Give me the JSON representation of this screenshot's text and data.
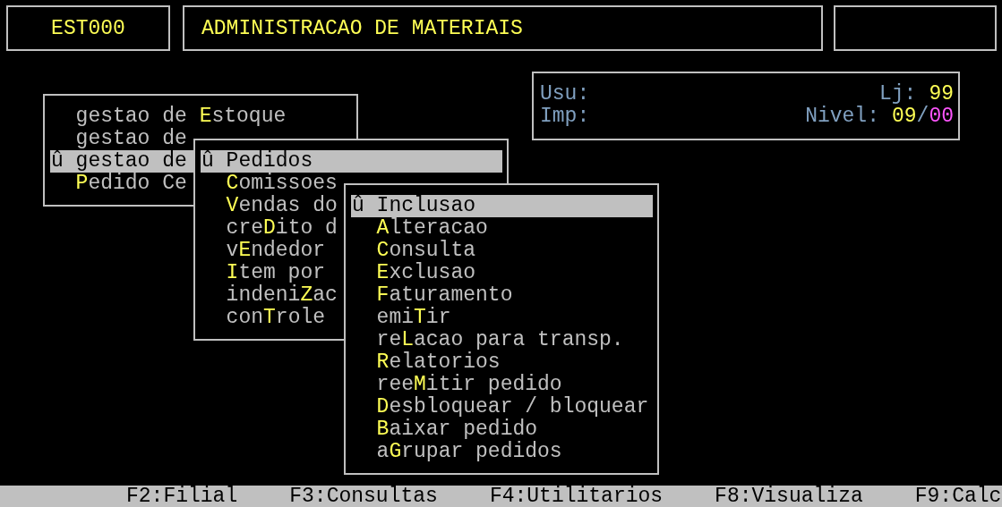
{
  "header": {
    "code": "EST000",
    "title": "ADMINISTRACAO DE MATERIAIS"
  },
  "info": {
    "usu_label": "Usu:",
    "imp_label": "Imp:",
    "lj_label": "Lj:",
    "lj_value": "99",
    "nivel_label": "Nivel:",
    "nivel_value": "09",
    "nivel_separator": "/",
    "nivel_max": "00"
  },
  "menus": [
    {
      "items": [
        {
          "pre": "gestao de ",
          "key": "E",
          "post": "stoque",
          "selected": false
        },
        {
          "pre": "gestao de",
          "selected": false
        },
        {
          "marker": "û",
          "pre": "gestao de",
          "selected": true
        },
        {
          "key": "P",
          "post": "edido Ce",
          "selected": false
        }
      ]
    },
    {
      "items": [
        {
          "marker": "û",
          "pre": "Pedidos",
          "selected": true
        },
        {
          "key": "C",
          "post": "omissoes",
          "selected": false
        },
        {
          "key": "V",
          "post": "endas do",
          "selected": false
        },
        {
          "pre": "cre",
          "key": "D",
          "post": "ito d",
          "selected": false
        },
        {
          "pre": "v",
          "key": "E",
          "post": "ndedor",
          "selected": false
        },
        {
          "key": "I",
          "post": "tem por",
          "selected": false
        },
        {
          "pre": "indeni",
          "key": "Z",
          "post": "ac",
          "selected": false
        },
        {
          "pre": "con",
          "key": "T",
          "post": "role",
          "selected": false
        }
      ]
    },
    {
      "items": [
        {
          "marker": "û",
          "pre": "Inclusao",
          "selected": true
        },
        {
          "key": "A",
          "post": "lteracao",
          "selected": false
        },
        {
          "key": "C",
          "post": "onsulta",
          "selected": false
        },
        {
          "key": "E",
          "post": "xclusao",
          "selected": false
        },
        {
          "key": "F",
          "post": "aturamento",
          "selected": false
        },
        {
          "pre": "emi",
          "key": "T",
          "post": "ir",
          "selected": false
        },
        {
          "pre": "re",
          "key": "L",
          "post": "acao para transp.",
          "selected": false
        },
        {
          "key": "R",
          "post": "elatorios",
          "selected": false
        },
        {
          "pre": "ree",
          "key": "M",
          "post": "itir pedido",
          "selected": false
        },
        {
          "key": "D",
          "post": "esbloquear / bloquear",
          "selected": false
        },
        {
          "key": "B",
          "post": "aixar pedido",
          "selected": false
        },
        {
          "pre": "a",
          "key": "G",
          "post": "rupar pedidos",
          "selected": false
        }
      ]
    }
  ],
  "function_keys": [
    "F2:Filial",
    "F3:Consultas",
    "F4:Utilitarios",
    "F8:Visualiza",
    "F9:Calc"
  ]
}
